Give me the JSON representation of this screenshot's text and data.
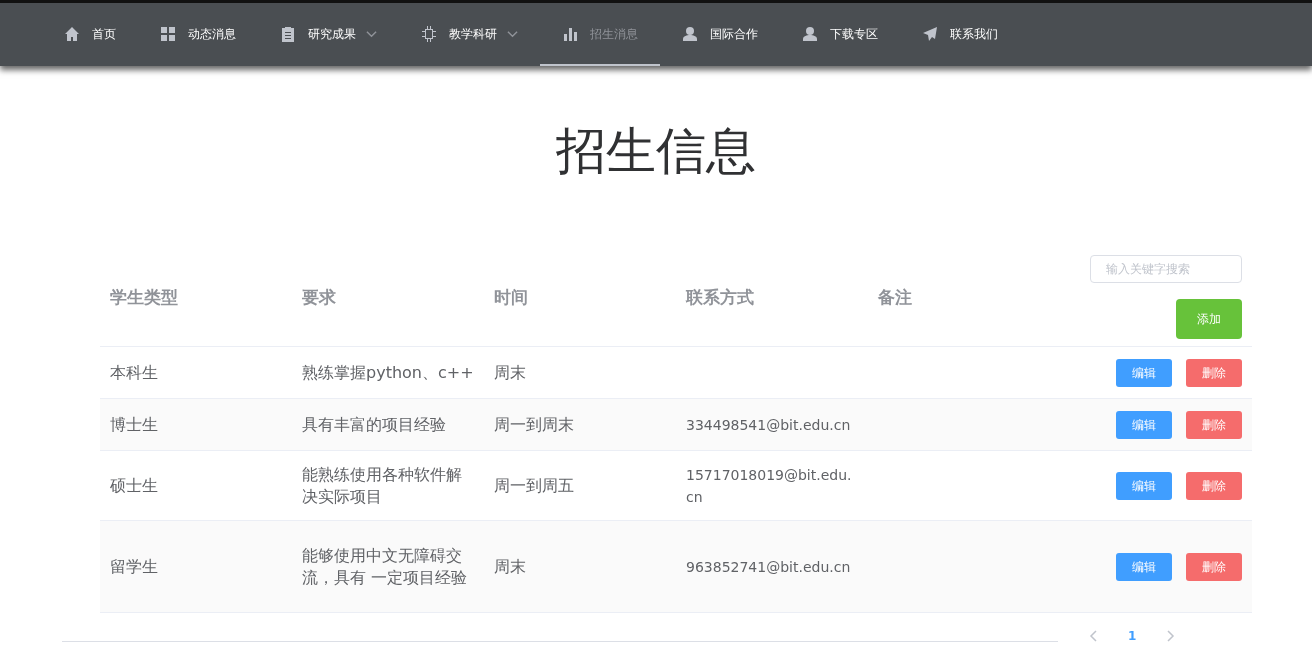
{
  "nav": [
    {
      "label": "首页",
      "kind": "home",
      "dropdown": false,
      "selected": false
    },
    {
      "label": "动态消息",
      "kind": "grid",
      "dropdown": false,
      "selected": false
    },
    {
      "label": "研究成果",
      "kind": "clipboard",
      "dropdown": true,
      "selected": false
    },
    {
      "label": "教学科研",
      "kind": "chip",
      "dropdown": true,
      "selected": false
    },
    {
      "label": "招生消息",
      "kind": "chart",
      "dropdown": false,
      "selected": true
    },
    {
      "label": "国际合作",
      "kind": "user",
      "dropdown": false,
      "selected": false
    },
    {
      "label": "下载专区",
      "kind": "user",
      "dropdown": false,
      "selected": false
    },
    {
      "label": "联系我们",
      "kind": "plane",
      "dropdown": false,
      "selected": false
    }
  ],
  "title": "招生信息",
  "search": {
    "placeholder": "输入关键字搜索"
  },
  "add_button": "添加",
  "table": {
    "columns": [
      "学生类型",
      "要求",
      "时间",
      "联系方式",
      "备注"
    ],
    "rows": [
      {
        "cells": [
          "本科生",
          "熟练掌握python、c++",
          "周末",
          "",
          ""
        ],
        "edit": "编辑",
        "delete": "删除"
      },
      {
        "cells": [
          "博士生",
          "具有丰富的项目经验",
          "周一到周末",
          "334498541@bit.edu.cn",
          ""
        ],
        "edit": "编辑",
        "delete": "删除"
      },
      {
        "cells": [
          "硕士生",
          "能熟练使用各种软件解决实际项目",
          "周一到周五",
          "15717018019@bit.edu.cn",
          ""
        ],
        "edit": "编辑",
        "delete": "删除"
      },
      {
        "cells": [
          "留学生",
          "能够使用中文无障碍交流，具有 一定项目经验",
          "周末",
          "963852741@bit.edu.cn",
          ""
        ],
        "edit": "编辑",
        "delete": "删除"
      }
    ]
  },
  "pagination": {
    "pages": [
      {
        "label": "1",
        "selected": true
      }
    ]
  }
}
